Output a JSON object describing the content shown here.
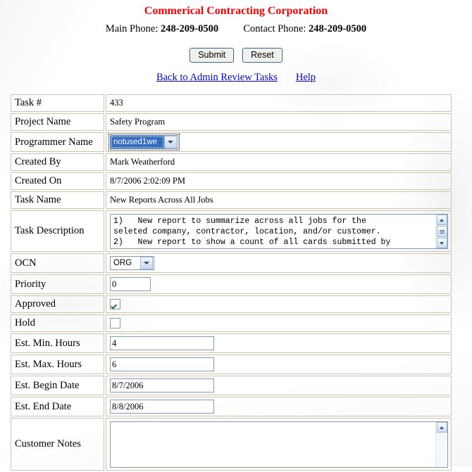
{
  "header": {
    "company": "Commerical Contracting Corporation",
    "main_phone_label": "Main Phone:",
    "main_phone": "248-209-0500",
    "contact_phone_label": "Contact Phone:",
    "contact_phone": "248-209-0500",
    "title_color": "#FF0000"
  },
  "toolbar": {
    "submit_label": "Submit",
    "reset_label": "Reset",
    "back_link": "Back to Admin Review Tasks",
    "help_link": "Help",
    "link_color": "#0000EE"
  },
  "form": {
    "task_number": {
      "label": "Task #",
      "value": "433"
    },
    "project_name": {
      "label": "Project Name",
      "value": "Safety Program"
    },
    "programmer_name": {
      "label": "Programmer Name",
      "selected": "notused1we",
      "options": [
        "notused1we"
      ],
      "focused": true,
      "highlight_color": "#316AC5"
    },
    "created_by": {
      "label": "Created By",
      "value": "Mark Weatherford"
    },
    "created_on": {
      "label": "Created On",
      "value": "8/7/2006 2:02:09 PM"
    },
    "task_name": {
      "label": "Task Name",
      "value": "New Reports Across All Jobs"
    },
    "task_description": {
      "label": "Task Description",
      "value": "1)   New report to summarize across all jobs for the\nseleted company, contractor, location, and/or customer.\n2)   New report to show a count of all cards submitted by"
    },
    "ocn": {
      "label": "OCN",
      "selected": "ORG",
      "options": [
        "ORG"
      ]
    },
    "priority": {
      "label": "Priority",
      "value": "0"
    },
    "approved": {
      "label": "Approved",
      "checked": true
    },
    "hold": {
      "label": "Hold",
      "checked": false
    },
    "est_min_hours": {
      "label": "Est. Min. Hours",
      "value": "4"
    },
    "est_max_hours": {
      "label": "Est. Max. Hours",
      "value": "6"
    },
    "est_begin_date": {
      "label": "Est. Begin Date",
      "value": "8/7/2006"
    },
    "est_end_date": {
      "label": "Est. End Date",
      "value": "8/8/2006"
    },
    "customer_notes": {
      "label": "Customer Notes",
      "value": ""
    }
  }
}
